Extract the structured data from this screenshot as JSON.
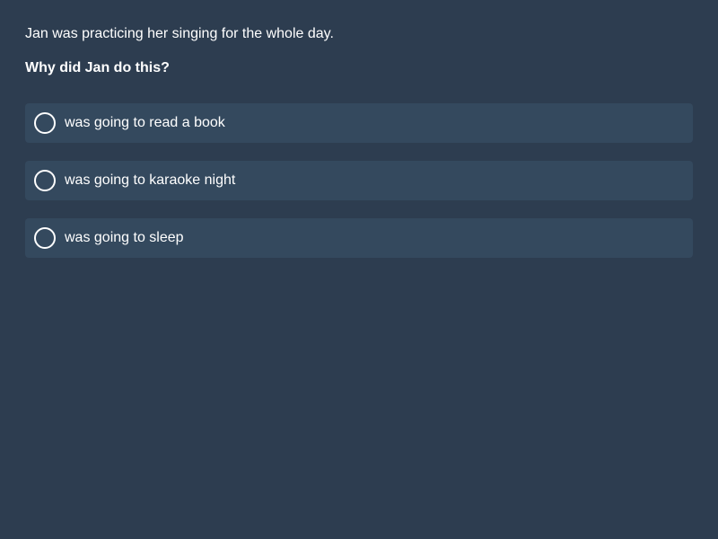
{
  "context": "Jan was practicing her singing for the whole day.",
  "question": "Why did Jan do this?",
  "options": [
    {
      "label": "was going to read a book",
      "selected": false
    },
    {
      "label": "was going to karaoke night",
      "selected": false
    },
    {
      "label": "was going to sleep",
      "selected": false
    }
  ],
  "colors": {
    "background": "#2d3d50",
    "option_background": "#34495e",
    "text": "#ffffff"
  }
}
